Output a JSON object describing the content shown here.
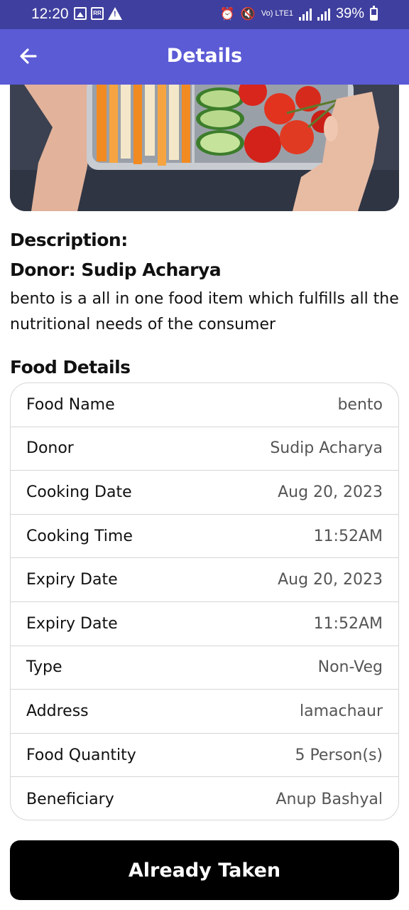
{
  "status_bar": {
    "time": "12:20",
    "network_label": "Vo) LTE1",
    "battery": "39%"
  },
  "app_bar": {
    "title": "Details"
  },
  "description": {
    "heading": "Description:",
    "donor_line": "Donor: Sudip Acharya",
    "text": "bento is a all in one food item which fulfills all the nutritional needs of the consumer"
  },
  "food_details": {
    "heading": "Food Details",
    "rows": [
      {
        "label": "Food Name",
        "value": "bento"
      },
      {
        "label": "Donor",
        "value": "Sudip Acharya"
      },
      {
        "label": "Cooking Date",
        "value": "Aug 20, 2023"
      },
      {
        "label": "Cooking Time",
        "value": "11:52AM"
      },
      {
        "label": "Expiry Date",
        "value": "Aug 20, 2023"
      },
      {
        "label": "Expiry Date",
        "value": "11:52AM"
      },
      {
        "label": "Type",
        "value": "Non-Veg"
      },
      {
        "label": "Address",
        "value": "lamachaur"
      },
      {
        "label": "Food Quantity",
        "value": "5 Person(s)"
      },
      {
        "label": "Beneficiary",
        "value": "Anup Bashyal"
      }
    ]
  },
  "action_button": {
    "label": "Already Taken"
  },
  "colors": {
    "status_bar": "#3f3f9f",
    "app_bar": "#5b5bd6",
    "button": "#000000"
  }
}
